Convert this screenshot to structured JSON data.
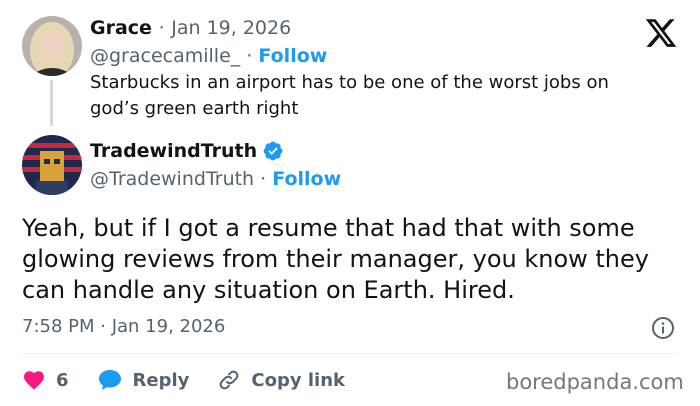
{
  "parent_tweet": {
    "display_name": "Grace",
    "date": "Jan 19, 2026",
    "handle": "@gracecamille_",
    "follow_label": "Follow",
    "text": "Starbucks in an airport has to be one of the worst jobs on god’s green earth right"
  },
  "reply_tweet": {
    "display_name": "TradewindTruth",
    "verified": true,
    "handle": "@TradewindTruth",
    "follow_label": "Follow",
    "text": "Yeah, but if I got a resume that had that with some glowing reviews from their manager, you know they can handle any situation on Earth.  Hired.",
    "timestamp": "7:58 PM · Jan 19, 2026"
  },
  "actions": {
    "like_count": "6",
    "reply_label": "Reply",
    "copy_link_label": "Copy link"
  },
  "separator": "·",
  "watermark": "boredpanda.com",
  "colors": {
    "accent": "#1d9bf0",
    "like": "#f91880",
    "muted": "#536471",
    "text": "#0f1419"
  }
}
